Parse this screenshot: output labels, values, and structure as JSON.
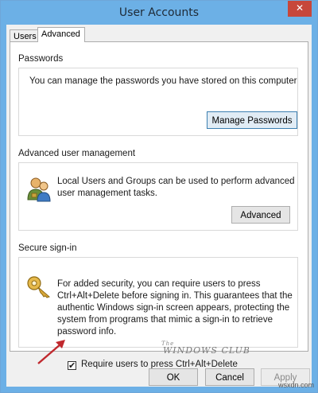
{
  "window": {
    "title": "User Accounts",
    "close_label": "✕"
  },
  "tabs": [
    {
      "label": "Users"
    },
    {
      "label": "Advanced"
    }
  ],
  "passwords": {
    "title": "Passwords",
    "text": "You can manage the passwords you have stored on this computer",
    "button": "Manage Passwords"
  },
  "advanced_user_management": {
    "title": "Advanced user management",
    "text_line1": "Local Users and Groups can be used to perform advanced",
    "text_line2": "user management tasks.",
    "button": "Advanced"
  },
  "secure_signin": {
    "title": "Secure sign-in",
    "text_lines": [
      "For added security, you can require users to press",
      "Ctrl+Alt+Delete before signing in. This guarantees that the",
      "authentic Windows sign-in screen appears, protecting the",
      "system from programs that mimic a sign-in to retrieve",
      "password info."
    ],
    "checkbox_label": "Require users to press Ctrl+Alt+Delete",
    "checkbox_checked": true
  },
  "footer": {
    "ok": "OK",
    "cancel": "Cancel",
    "apply": "Apply"
  },
  "watermark": "The Windows Club",
  "site_watermark": "wsxdn.com",
  "colors": {
    "title_bar": "#6cb0e6",
    "close_button": "#c7473b",
    "arrow": "#c0282d"
  }
}
